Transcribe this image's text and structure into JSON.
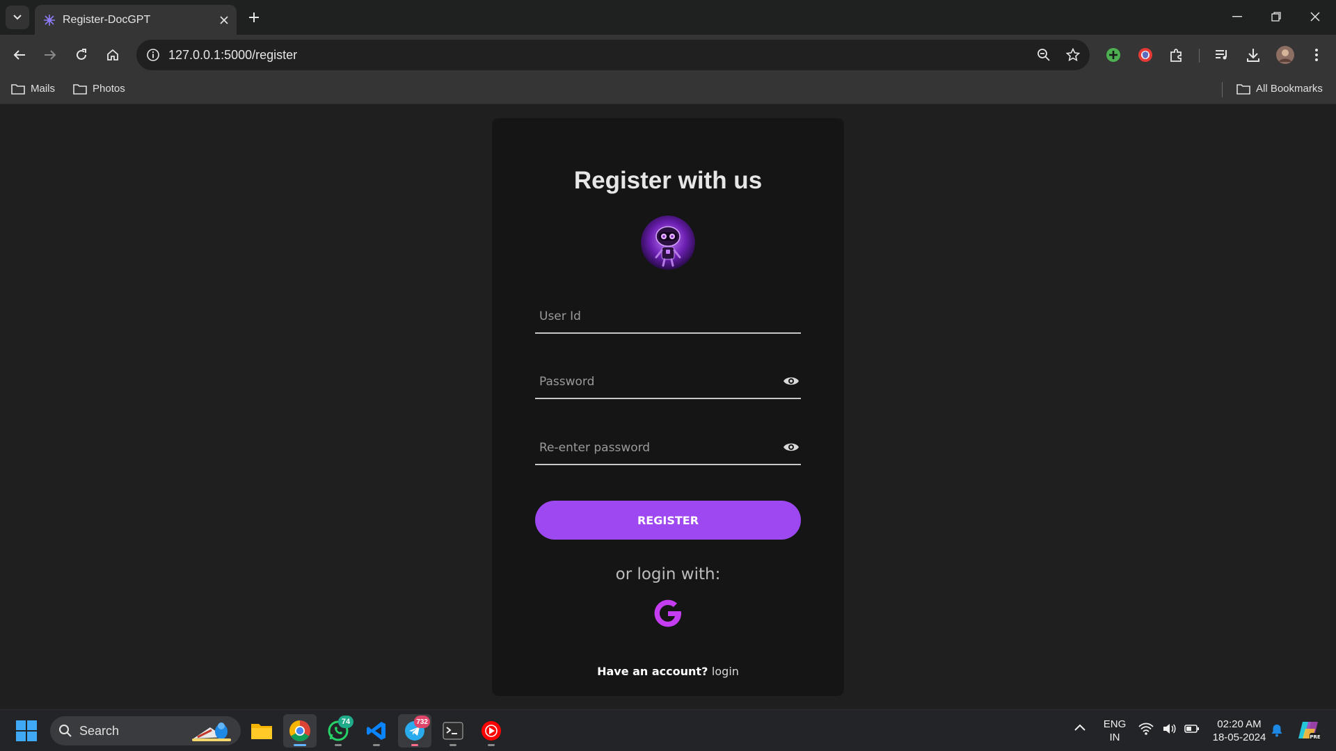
{
  "browser": {
    "tab_title": "Register-DocGPT",
    "url": "127.0.0.1:5000/register",
    "bookmarks": [
      {
        "label": "Mails"
      },
      {
        "label": "Photos"
      }
    ],
    "all_bookmarks_label": "All Bookmarks"
  },
  "page": {
    "title": "Register with us",
    "user_id_placeholder": "User Id",
    "password_placeholder": "Password",
    "reenter_placeholder": "Re-enter password",
    "register_label": "REGISTER",
    "or_login_text": "or login with:",
    "have_account_text": "Have an account?",
    "login_link": "login"
  },
  "taskbar": {
    "search_label": "Search",
    "whatsapp_badge": "74",
    "telegram_badge": "732",
    "lang_top": "ENG",
    "lang_bottom": "IN",
    "time": "02:20 AM",
    "date": "18-05-2024"
  },
  "colors": {
    "accent_purple": "#9d48f0",
    "google_icon": "#c43df0"
  }
}
